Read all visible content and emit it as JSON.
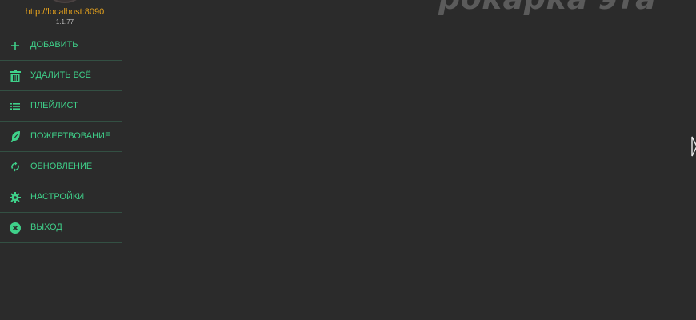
{
  "header": {
    "server_url": "http://localhost:8090",
    "version": "1.1.77"
  },
  "menu": {
    "items": [
      {
        "label": "ДОБАВИТЬ",
        "icon": "plus-icon"
      },
      {
        "label": "УДАЛИТЬ ВСЁ",
        "icon": "trash-icon"
      },
      {
        "label": "ПЛЕЙЛИСТ",
        "icon": "list-icon"
      },
      {
        "label": "ПОЖЕРТВОВАНИЕ",
        "icon": "feather-icon"
      },
      {
        "label": "ОБНОВЛЕНИЕ",
        "icon": "refresh-icon"
      },
      {
        "label": "НАСТРОЙКИ",
        "icon": "gear-icon"
      },
      {
        "label": "ВЫХОД",
        "icon": "close-circle-icon"
      }
    ]
  },
  "background": {
    "watermark_text": "рокарка эта"
  },
  "colors": {
    "background": "#2b2b2b",
    "accent": "#3fd18a",
    "url": "#e6a21d",
    "divider": "#335043"
  }
}
